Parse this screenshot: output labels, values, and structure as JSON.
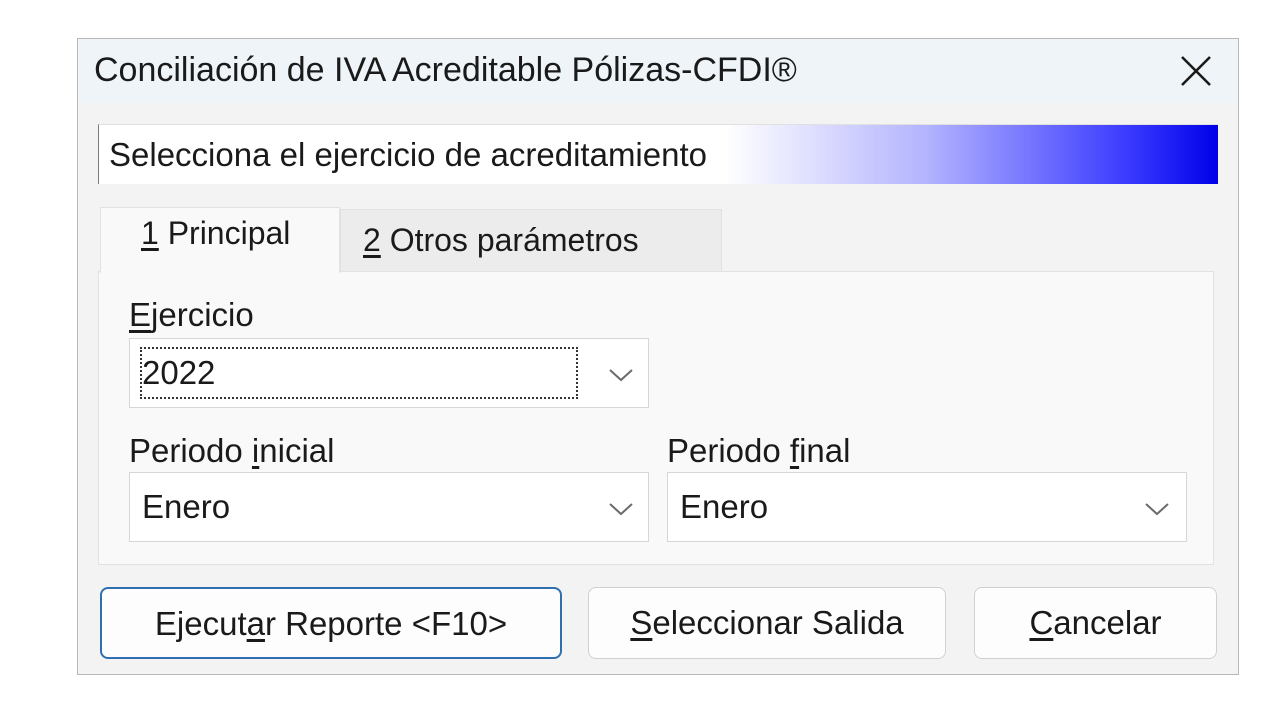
{
  "window": {
    "title": "Conciliación de IVA Acreditable Pólizas-CFDI®",
    "close_icon": "close-icon"
  },
  "banner": {
    "text": "Selecciona el ejercicio de acreditamiento",
    "gradient_colors": [
      "#ffffff",
      "#0000e8"
    ]
  },
  "tabs": [
    {
      "key": "1",
      "rest": " Principal",
      "selected": true
    },
    {
      "key": "2",
      "rest": " Otros parámetros",
      "selected": false
    }
  ],
  "fields": {
    "ejercicio": {
      "label_key": "E",
      "label_rest": "jercicio",
      "value": "2022"
    },
    "periodo_inicial": {
      "label_pre": "Periodo ",
      "label_key": "i",
      "label_rest": "nicial",
      "value": "Enero"
    },
    "periodo_final": {
      "label_pre": "Periodo ",
      "label_key": "f",
      "label_rest": "inal",
      "value": "Enero"
    }
  },
  "buttons": {
    "run": {
      "pre": "Ejecut",
      "key": "a",
      "rest": "r Reporte <F10>"
    },
    "output": {
      "pre": "",
      "key": "S",
      "rest": "eleccionar Salida"
    },
    "cancel": {
      "pre": "",
      "key": "C",
      "rest": "ancelar"
    }
  },
  "colors": {
    "accent_border": "#2f6fb0",
    "titlebar_bg": "#eef4f8"
  }
}
